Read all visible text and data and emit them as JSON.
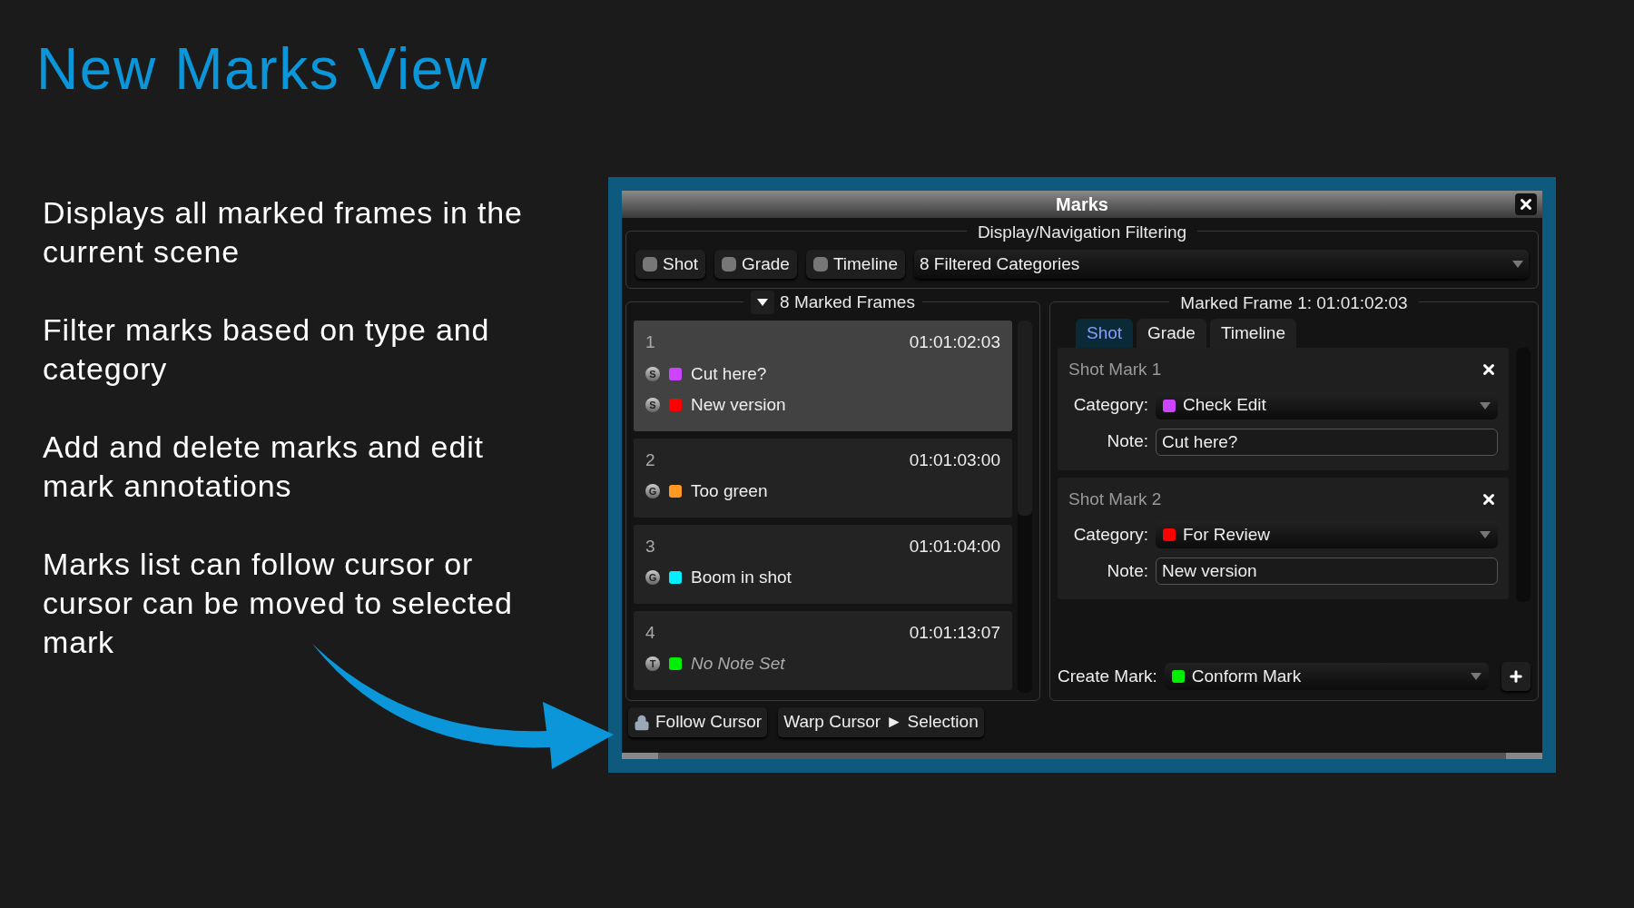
{
  "slide": {
    "title": "New Marks View",
    "bullets": [
      "Displays all marked frames in the current scene",
      "Filter marks based on type and category",
      "Add and delete marks and edit mark annotations",
      "Marks list can follow cursor or cursor can be moved to selected mark"
    ]
  },
  "window": {
    "title": "Marks"
  },
  "filtering": {
    "label": "Display/Navigation Filtering",
    "toggles": [
      {
        "label": "Shot",
        "on": false
      },
      {
        "label": "Grade",
        "on": false
      },
      {
        "label": "Timeline",
        "on": false
      }
    ],
    "categories": "8 Filtered Categories"
  },
  "frames": {
    "header": "8 Marked Frames",
    "expanded": true,
    "items": [
      {
        "number": "1",
        "timecode": "01:01:02:03",
        "selected": true,
        "marks": [
          {
            "type": "S",
            "color": "#cc44ff",
            "note": "Cut here?",
            "note_set": true
          },
          {
            "type": "S",
            "color": "#ff0000",
            "note": "New version",
            "note_set": true
          }
        ]
      },
      {
        "number": "2",
        "timecode": "01:01:03:00",
        "selected": false,
        "marks": [
          {
            "type": "G",
            "color": "#ff9922",
            "note": "Too green",
            "note_set": true
          }
        ]
      },
      {
        "number": "3",
        "timecode": "01:01:04:00",
        "selected": false,
        "marks": [
          {
            "type": "G",
            "color": "#00eeff",
            "note": "Boom in shot",
            "note_set": true
          }
        ]
      },
      {
        "number": "4",
        "timecode": "01:01:13:07",
        "selected": false,
        "marks": [
          {
            "type": "T",
            "color": "#00ee00",
            "note": "No Note Set",
            "note_set": false
          }
        ]
      }
    ]
  },
  "detail": {
    "title": "Marked Frame 1: 01:01:02:03",
    "tabs": [
      {
        "label": "Shot",
        "selected": true
      },
      {
        "label": "Grade",
        "selected": false
      },
      {
        "label": "Timeline",
        "selected": false
      }
    ],
    "marks": [
      {
        "title": "Shot Mark 1",
        "category_label": "Category:",
        "category": "Check Edit",
        "color": "#cc44ff",
        "note_label": "Note:",
        "note": "Cut here?"
      },
      {
        "title": "Shot Mark 2",
        "category_label": "Category:",
        "category": "For Review",
        "color": "#ff0000",
        "note_label": "Note:",
        "note": "New version"
      }
    ],
    "create": {
      "label": "Create Mark:",
      "category": "Conform Mark",
      "color": "#00ee00"
    }
  },
  "footer": {
    "buttons": [
      {
        "kind": "lock",
        "label": "Follow Cursor"
      },
      {
        "kind": "plain",
        "label": "Warp Cursor ► Selection"
      }
    ]
  }
}
